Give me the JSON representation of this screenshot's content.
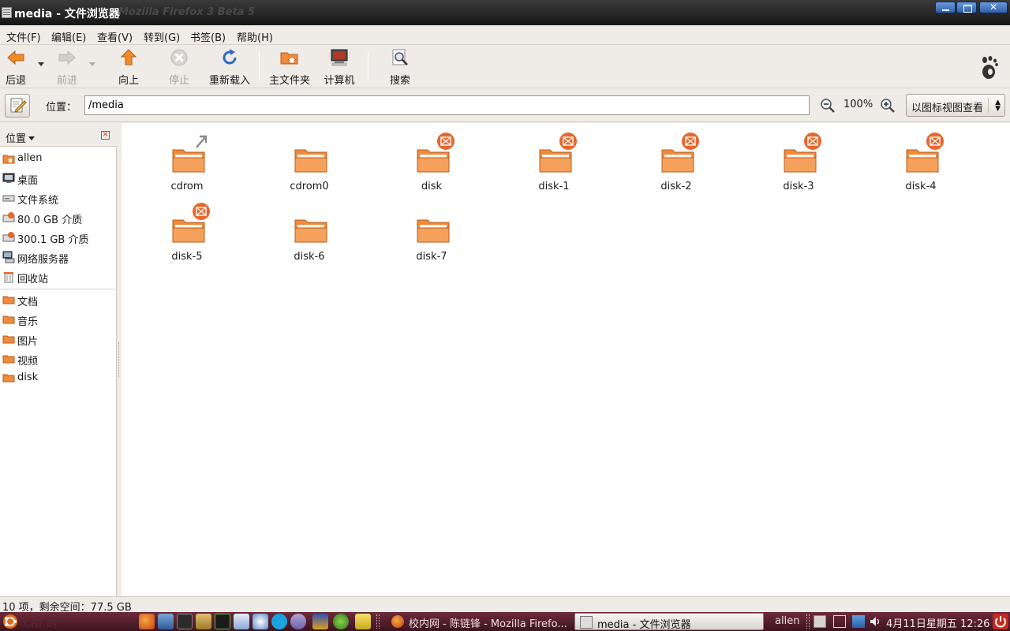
{
  "window": {
    "title": "media - 文件浏览器",
    "ghost_title": "Mozilla Firefox 3 Beta 5"
  },
  "menu": [
    "文件(F)",
    "编辑(E)",
    "查看(V)",
    "转到(G)",
    "书签(B)",
    "帮助(H)"
  ],
  "toolbar": {
    "back": "后退",
    "forward": "前进",
    "up": "向上",
    "stop": "停止",
    "reload": "重新载入",
    "home": "主文件夹",
    "computer": "计算机",
    "search": "搜索"
  },
  "location": {
    "label": "位置：",
    "path": "/media",
    "zoom": "100%",
    "view_mode": "以图标视图查看"
  },
  "sidebar": {
    "header": "位置",
    "places": [
      {
        "label": "allen",
        "icon": "home-icon"
      },
      {
        "label": "桌面",
        "icon": "desktop-icon"
      },
      {
        "label": "文件系统",
        "icon": "drive-icon"
      },
      {
        "label": "80.0 GB 介质",
        "icon": "drive-icon"
      },
      {
        "label": "300.1 GB 介质",
        "icon": "drive-icon"
      },
      {
        "label": "网络服务器",
        "icon": "network-icon"
      },
      {
        "label": "回收站",
        "icon": "trash-icon"
      }
    ],
    "bookmarks": [
      {
        "label": "文档"
      },
      {
        "label": "音乐"
      },
      {
        "label": "图片"
      },
      {
        "label": "视频"
      },
      {
        "label": "disk"
      }
    ]
  },
  "files": [
    {
      "name": "cdrom",
      "emblem": "symlink"
    },
    {
      "name": "cdrom0",
      "emblem": "none"
    },
    {
      "name": "disk",
      "emblem": "unreadable"
    },
    {
      "name": "disk-1",
      "emblem": "unreadable"
    },
    {
      "name": "disk-2",
      "emblem": "unreadable"
    },
    {
      "name": "disk-3",
      "emblem": "unreadable"
    },
    {
      "name": "disk-4",
      "emblem": "unreadable"
    },
    {
      "name": "disk-5",
      "emblem": "unreadable"
    },
    {
      "name": "disk-6",
      "emblem": "none"
    },
    {
      "name": "disk-7",
      "emblem": "none"
    }
  ],
  "status": "10 项，剩余空间：77.5 GB",
  "panel": {
    "ghost_left": "CRT 的 ...",
    "tasks": [
      {
        "label": "校内网 - 陈链锋 - Mozilla Firefo...",
        "active": false
      },
      {
        "label": "media - 文件浏览器",
        "active": true
      }
    ],
    "user": "allen",
    "clock": "4月11日星期五 12:26"
  },
  "colors": {
    "folder": "#f08a3c",
    "panel": "#5a2231",
    "emblem": "#e8672c"
  }
}
